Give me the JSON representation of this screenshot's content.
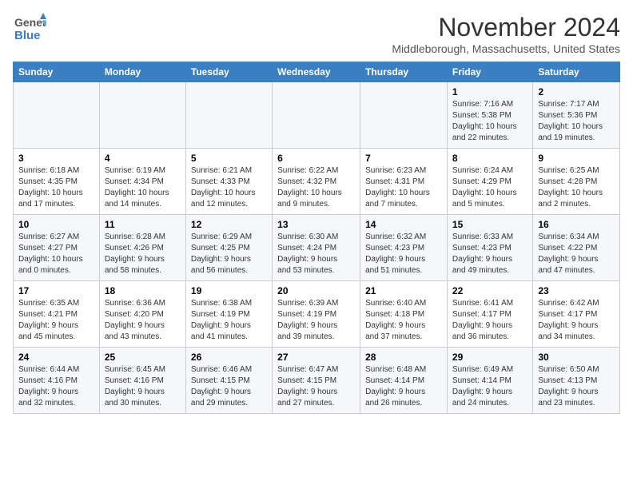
{
  "header": {
    "logo_line1": "General",
    "logo_line2": "Blue",
    "title": "November 2024",
    "subtitle": "Middleborough, Massachusetts, United States"
  },
  "weekdays": [
    "Sunday",
    "Monday",
    "Tuesday",
    "Wednesday",
    "Thursday",
    "Friday",
    "Saturday"
  ],
  "weeks": [
    [
      {
        "day": "",
        "info": ""
      },
      {
        "day": "",
        "info": ""
      },
      {
        "day": "",
        "info": ""
      },
      {
        "day": "",
        "info": ""
      },
      {
        "day": "",
        "info": ""
      },
      {
        "day": "1",
        "info": "Sunrise: 7:16 AM\nSunset: 5:38 PM\nDaylight: 10 hours\nand 22 minutes."
      },
      {
        "day": "2",
        "info": "Sunrise: 7:17 AM\nSunset: 5:36 PM\nDaylight: 10 hours\nand 19 minutes."
      }
    ],
    [
      {
        "day": "3",
        "info": "Sunrise: 6:18 AM\nSunset: 4:35 PM\nDaylight: 10 hours\nand 17 minutes."
      },
      {
        "day": "4",
        "info": "Sunrise: 6:19 AM\nSunset: 4:34 PM\nDaylight: 10 hours\nand 14 minutes."
      },
      {
        "day": "5",
        "info": "Sunrise: 6:21 AM\nSunset: 4:33 PM\nDaylight: 10 hours\nand 12 minutes."
      },
      {
        "day": "6",
        "info": "Sunrise: 6:22 AM\nSunset: 4:32 PM\nDaylight: 10 hours\nand 9 minutes."
      },
      {
        "day": "7",
        "info": "Sunrise: 6:23 AM\nSunset: 4:31 PM\nDaylight: 10 hours\nand 7 minutes."
      },
      {
        "day": "8",
        "info": "Sunrise: 6:24 AM\nSunset: 4:29 PM\nDaylight: 10 hours\nand 5 minutes."
      },
      {
        "day": "9",
        "info": "Sunrise: 6:25 AM\nSunset: 4:28 PM\nDaylight: 10 hours\nand 2 minutes."
      }
    ],
    [
      {
        "day": "10",
        "info": "Sunrise: 6:27 AM\nSunset: 4:27 PM\nDaylight: 10 hours\nand 0 minutes."
      },
      {
        "day": "11",
        "info": "Sunrise: 6:28 AM\nSunset: 4:26 PM\nDaylight: 9 hours\nand 58 minutes."
      },
      {
        "day": "12",
        "info": "Sunrise: 6:29 AM\nSunset: 4:25 PM\nDaylight: 9 hours\nand 56 minutes."
      },
      {
        "day": "13",
        "info": "Sunrise: 6:30 AM\nSunset: 4:24 PM\nDaylight: 9 hours\nand 53 minutes."
      },
      {
        "day": "14",
        "info": "Sunrise: 6:32 AM\nSunset: 4:23 PM\nDaylight: 9 hours\nand 51 minutes."
      },
      {
        "day": "15",
        "info": "Sunrise: 6:33 AM\nSunset: 4:23 PM\nDaylight: 9 hours\nand 49 minutes."
      },
      {
        "day": "16",
        "info": "Sunrise: 6:34 AM\nSunset: 4:22 PM\nDaylight: 9 hours\nand 47 minutes."
      }
    ],
    [
      {
        "day": "17",
        "info": "Sunrise: 6:35 AM\nSunset: 4:21 PM\nDaylight: 9 hours\nand 45 minutes."
      },
      {
        "day": "18",
        "info": "Sunrise: 6:36 AM\nSunset: 4:20 PM\nDaylight: 9 hours\nand 43 minutes."
      },
      {
        "day": "19",
        "info": "Sunrise: 6:38 AM\nSunset: 4:19 PM\nDaylight: 9 hours\nand 41 minutes."
      },
      {
        "day": "20",
        "info": "Sunrise: 6:39 AM\nSunset: 4:19 PM\nDaylight: 9 hours\nand 39 minutes."
      },
      {
        "day": "21",
        "info": "Sunrise: 6:40 AM\nSunset: 4:18 PM\nDaylight: 9 hours\nand 37 minutes."
      },
      {
        "day": "22",
        "info": "Sunrise: 6:41 AM\nSunset: 4:17 PM\nDaylight: 9 hours\nand 36 minutes."
      },
      {
        "day": "23",
        "info": "Sunrise: 6:42 AM\nSunset: 4:17 PM\nDaylight: 9 hours\nand 34 minutes."
      }
    ],
    [
      {
        "day": "24",
        "info": "Sunrise: 6:44 AM\nSunset: 4:16 PM\nDaylight: 9 hours\nand 32 minutes."
      },
      {
        "day": "25",
        "info": "Sunrise: 6:45 AM\nSunset: 4:16 PM\nDaylight: 9 hours\nand 30 minutes."
      },
      {
        "day": "26",
        "info": "Sunrise: 6:46 AM\nSunset: 4:15 PM\nDaylight: 9 hours\nand 29 minutes."
      },
      {
        "day": "27",
        "info": "Sunrise: 6:47 AM\nSunset: 4:15 PM\nDaylight: 9 hours\nand 27 minutes."
      },
      {
        "day": "28",
        "info": "Sunrise: 6:48 AM\nSunset: 4:14 PM\nDaylight: 9 hours\nand 26 minutes."
      },
      {
        "day": "29",
        "info": "Sunrise: 6:49 AM\nSunset: 4:14 PM\nDaylight: 9 hours\nand 24 minutes."
      },
      {
        "day": "30",
        "info": "Sunrise: 6:50 AM\nSunset: 4:13 PM\nDaylight: 9 hours\nand 23 minutes."
      }
    ]
  ]
}
